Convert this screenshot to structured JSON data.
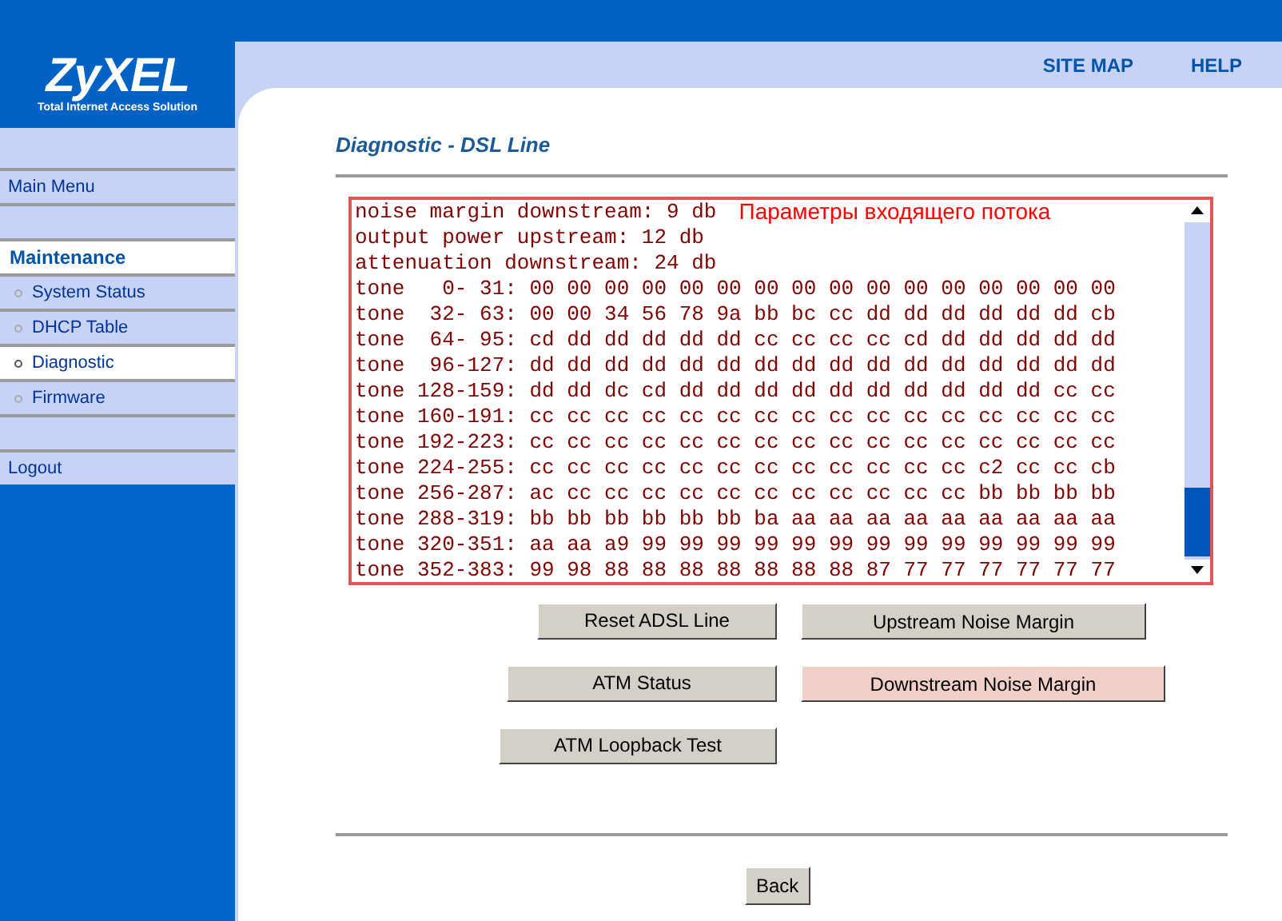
{
  "header": {
    "logo": "ZyXEL",
    "tagline": "Total Internet Access Solution",
    "links": [
      "SITE MAP",
      "HELP"
    ]
  },
  "sidebar": {
    "items": [
      {
        "kind": "link",
        "label": "Main Menu"
      },
      {
        "kind": "blank"
      },
      {
        "kind": "section",
        "label": "Maintenance"
      },
      {
        "kind": "subitem",
        "label": "System Status",
        "selected": false
      },
      {
        "kind": "subitem",
        "label": "DHCP Table",
        "selected": false
      },
      {
        "kind": "subitem",
        "label": "Diagnostic",
        "selected": true
      },
      {
        "kind": "subitem",
        "label": "Firmware",
        "selected": false
      },
      {
        "kind": "blank"
      },
      {
        "kind": "link",
        "label": "Logout"
      }
    ]
  },
  "page_title": "Diagnostic - DSL Line",
  "log": {
    "annotation": "Параметры входящего потока",
    "lines": [
      "noise margin downstream: 9 db",
      "output power upstream: 12 db",
      "attenuation downstream: 24 db",
      "tone   0- 31: 00 00 00 00 00 00 00 00 00 00 00 00 00 00 00 00",
      "tone  32- 63: 00 00 34 56 78 9a bb bc cc dd dd dd dd dd dd cb",
      "tone  64- 95: cd dd dd dd dd dd cc cc cc cc cd dd dd dd dd dd",
      "tone  96-127: dd dd dd dd dd dd dd dd dd dd dd dd dd dd dd dd",
      "tone 128-159: dd dd dc cd dd dd dd dd dd dd dd dd dd dd cc cc",
      "tone 160-191: cc cc cc cc cc cc cc cc cc cc cc cc cc cc cc cc",
      "tone 192-223: cc cc cc cc cc cc cc cc cc cc cc cc cc cc cc cc",
      "tone 224-255: cc cc cc cc cc cc cc cc cc cc cc cc c2 cc cc cb",
      "tone 256-287: ac cc cc cc cc cc cc cc cc cc cc cc bb bb bb bb",
      "tone 288-319: bb bb bb bb bb bb ba aa aa aa aa aa aa aa aa aa",
      "tone 320-351: aa aa a9 99 99 99 99 99 99 99 99 99 99 99 99 99",
      "tone 352-383: 99 98 88 88 88 88 88 88 88 87 77 77 77 77 77 77"
    ]
  },
  "buttons": [
    {
      "label": "Reset ADSL Line",
      "highlighted": false
    },
    {
      "label": "Upstream Noise Margin",
      "highlighted": false
    },
    {
      "label": "ATM Status",
      "highlighted": false
    },
    {
      "label": "Downstream Noise Margin",
      "highlighted": true
    },
    {
      "label": "ATM Loopback Test",
      "highlighted": false
    }
  ],
  "back_button": "Back"
}
